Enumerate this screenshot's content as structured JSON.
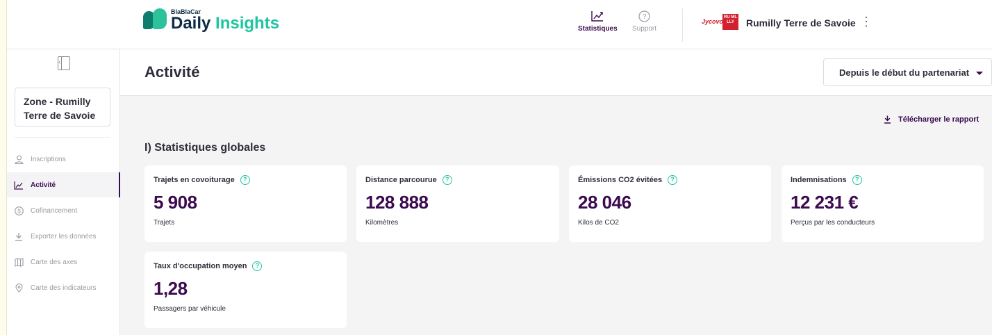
{
  "brand": {
    "small": "BlaBlaCar",
    "daily": "Daily",
    "insights": "Insights"
  },
  "nav": {
    "statistics": "Statistiques",
    "support": "Support"
  },
  "partner": {
    "logo_text": "Jycovoit",
    "badge_text": "RU ML LLY",
    "name": "Rumilly Terre de Savoie"
  },
  "sidebar": {
    "zone": "Zone - Rumilly Terre de Savoie",
    "items": [
      {
        "label": "Inscriptions",
        "icon": "user-icon"
      },
      {
        "label": "Activité",
        "icon": "chart-icon"
      },
      {
        "label": "Cofinancement",
        "icon": "dollar-icon"
      },
      {
        "label": "Exporter les données",
        "icon": "download-icon"
      },
      {
        "label": "Carte des axes",
        "icon": "map-icon"
      },
      {
        "label": "Carte des indicateurs",
        "icon": "pin-icon"
      }
    ]
  },
  "page": {
    "title": "Activité",
    "period": "Depuis le début du partenariat",
    "download": "Télécharger le rapport",
    "section": "I) Statistiques globales"
  },
  "cards": [
    {
      "title": "Trajets en covoiturage",
      "value": "5 908",
      "sub": "Trajets"
    },
    {
      "title": "Distance parcourue",
      "value": "128 888",
      "sub": "Kilomètres"
    },
    {
      "title": "Émissions CO2 évitées",
      "value": "28 046",
      "sub": "Kilos de CO2"
    },
    {
      "title": "Indemnisations",
      "value": "12 231 €",
      "sub": "Perçus par les conducteurs"
    },
    {
      "title": "Taux d'occupation moyen",
      "value": "1,28",
      "sub": "Passagers par véhicule"
    }
  ],
  "colors": {
    "accent": "#3b0a4f",
    "brand_green": "#1fc5a0",
    "brand_dark_green": "#0f7d6e"
  }
}
